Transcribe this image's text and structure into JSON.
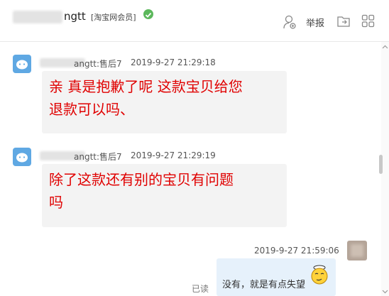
{
  "header": {
    "name_suffix": "ngtt",
    "member_label": "[淘宝网会员]",
    "report_label": "举报",
    "icons": [
      "verified-icon",
      "contact-icon",
      "report-icon",
      "folder-icon",
      "grid-icon"
    ]
  },
  "messages": [
    {
      "sender": "angtt:售后7",
      "time": "2019-9-27 21:29:18",
      "text_line1": "亲 真是抱歉了呢 这款宝贝给您",
      "text_line2": "退款可以吗、"
    },
    {
      "sender": "angtt:售后7",
      "time": "2019-9-27 21:29:19",
      "text_line1": "除了这款还有别的宝贝有问题",
      "text_line2": "吗"
    }
  ],
  "my_message": {
    "time": "2019-9-27 21:59:06",
    "text": "没有，就是有点失望",
    "read_status": "已读"
  },
  "colors": {
    "incoming_text": "#e00000",
    "incoming_bubble": "#f3f3f3",
    "outgoing_bubble": "#e6f1fb",
    "avatar_blue": "#5fa8e3",
    "verified_green": "#5cb85c"
  }
}
